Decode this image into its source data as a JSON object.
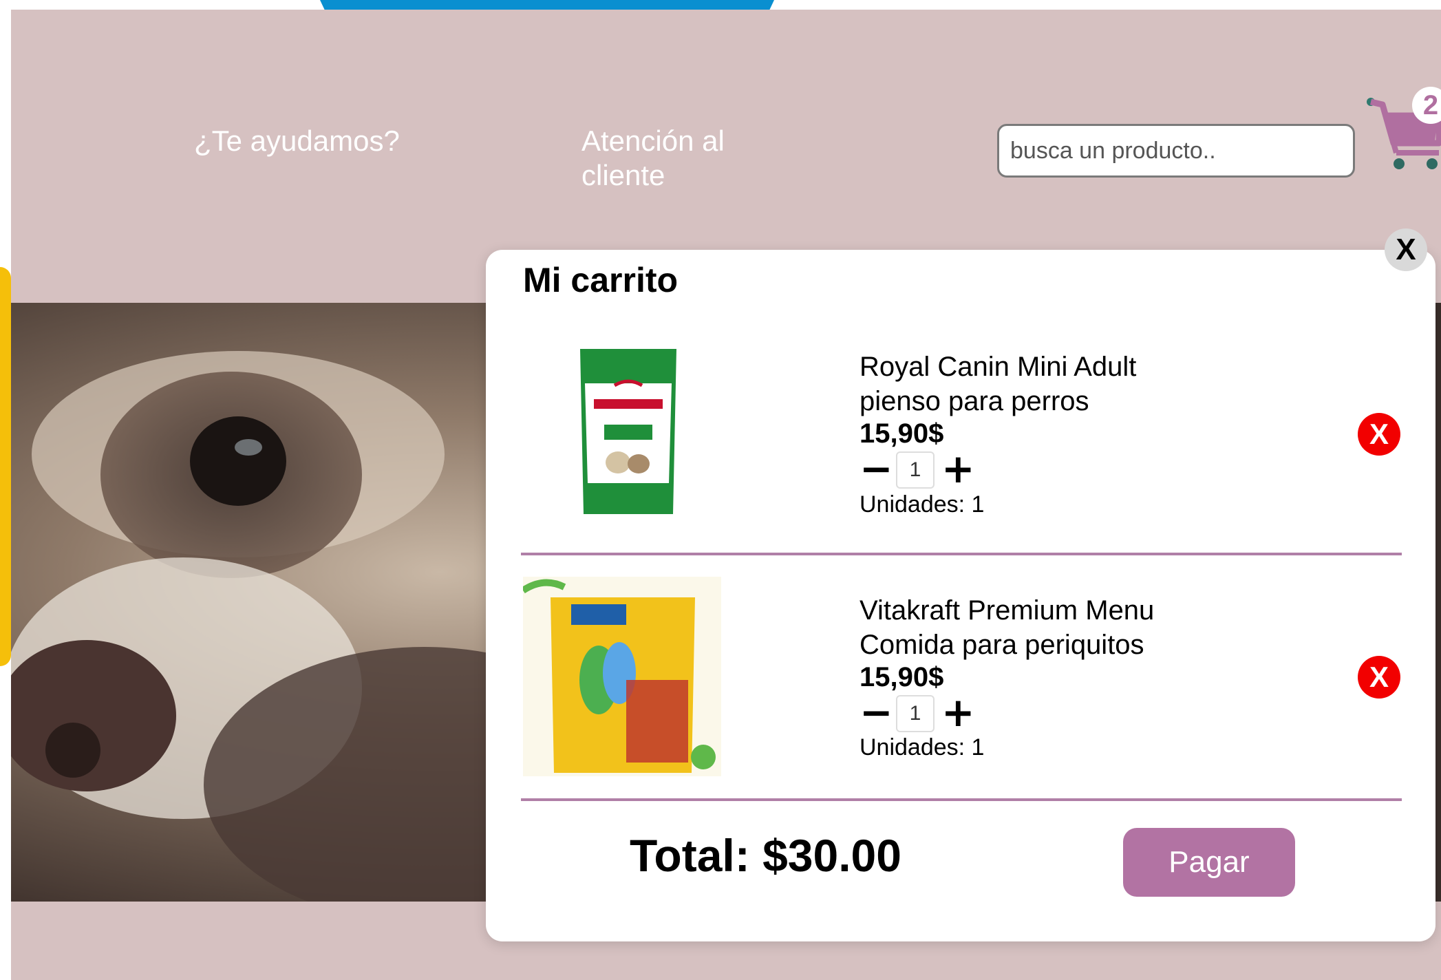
{
  "nav": {
    "help_label": "¿Te ayudamos?",
    "support_label": "Atención al cliente"
  },
  "search": {
    "placeholder": "busca un producto.."
  },
  "cart_icon": {
    "badge_count": "2",
    "color": "#b06fa0"
  },
  "cart": {
    "title": "Mi carrito",
    "close_label": "X",
    "items": [
      {
        "name": "Royal Canin Mini Adult pienso para perros",
        "price": "15,90$",
        "qty": "1",
        "units": "Unidades: 1",
        "remove_label": "X",
        "image_icon": "royal-canin-bag",
        "minus": "−",
        "plus": "+"
      },
      {
        "name": "Vitakraft Premium Menu Comida para periquitos",
        "price": "15,90$",
        "qty": "1",
        "units": "Unidades: 1",
        "remove_label": "X",
        "image_icon": "vitakraft-bag",
        "minus": "−",
        "plus": "+"
      }
    ],
    "total": "Total: $30.00",
    "pay_label": "Pagar"
  },
  "colors": {
    "page_background": "#d6c1c1",
    "accent": "#b273a3",
    "divider": "#b07fa7",
    "remove": "#f20000",
    "top_bar": "#0a8fd0",
    "side_bar": "#f5bf0a"
  }
}
